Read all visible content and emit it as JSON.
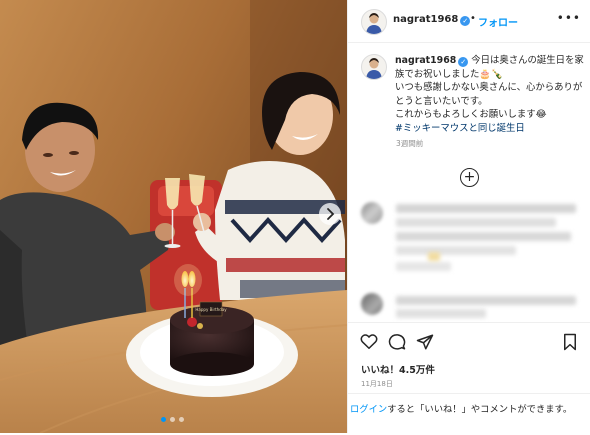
{
  "post": {
    "username": "nagrat1968",
    "follow_label": "フォロー",
    "more_label": "•••",
    "separator": "•",
    "caption_line1": "今日は奥さんの誕生日を家族でお祝いしました🎂🍾",
    "caption_line2": "いつも感謝しかない奥さんに、心からありがとうと言いたいです。",
    "caption_line3": "これからもよろしくお願いします😂",
    "hashtag": "#ミッキーマウスと同じ誕生日",
    "time_ago": "3週間前",
    "likes": "いいね！4.5万件",
    "date": "11月18日"
  },
  "photo": {
    "cake_card_text": "Happy Birthday",
    "carousel_dots": 3,
    "active_dot": 0
  },
  "icons": {
    "load_more": "plus-circle-icon",
    "like": "heart-icon",
    "comment": "comment-icon",
    "share": "paper-plane-icon",
    "save": "bookmark-icon",
    "next": "chevron-right-icon",
    "verified": "verified-badge-icon"
  },
  "login_bar": {
    "link": "ログイン",
    "text": "すると「いいね！」やコメントができます。"
  },
  "colors": {
    "link_blue": "#0095f6",
    "hashtag": "#00376b",
    "verified": "#3897f0",
    "muted": "#8e8e8e"
  }
}
